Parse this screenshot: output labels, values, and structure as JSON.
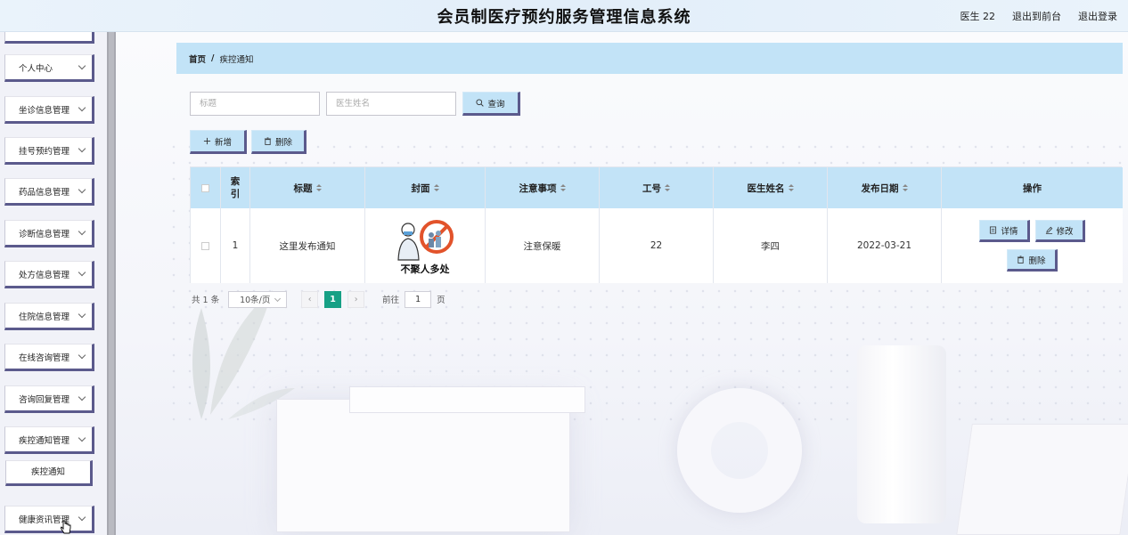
{
  "header": {
    "title": "会员制医疗预约服务管理信息系统",
    "user": "医生 22",
    "to_front": "退出到前台",
    "logout": "退出登录"
  },
  "sidebar": {
    "items": [
      {
        "label": ""
      },
      {
        "label": "个人中心"
      },
      {
        "label": "坐诊信息管理"
      },
      {
        "label": "挂号预约管理"
      },
      {
        "label": "药品信息管理"
      },
      {
        "label": "诊断信息管理"
      },
      {
        "label": "处方信息管理"
      },
      {
        "label": "住院信息管理"
      },
      {
        "label": "在线咨询管理"
      },
      {
        "label": "咨询回复管理"
      },
      {
        "label": "疾控通知管理"
      },
      {
        "label": "健康资讯管理"
      }
    ],
    "sub_item": "疾控通知"
  },
  "breadcrumb": {
    "home": "首页",
    "separator": "/",
    "current": "疾控通知"
  },
  "search": {
    "title_placeholder": "标题",
    "doctor_placeholder": "医生姓名",
    "query_label": "查询"
  },
  "toolbar": {
    "add_label": "新增",
    "delete_label": "删除"
  },
  "table": {
    "headers": {
      "index": "索引",
      "title": "标题",
      "cover": "封面",
      "notes": "注意事项",
      "job_no": "工号",
      "doctor": "医生姓名",
      "date": "发布日期",
      "ops": "操作"
    },
    "rows": [
      {
        "index": "1",
        "title": "这里发布通知",
        "cover_text": "不聚人多处",
        "notes": "注意保暖",
        "job_no": "22",
        "doctor": "李四",
        "date": "2022-03-21"
      }
    ],
    "ops": {
      "detail": "详情",
      "edit": "修改",
      "delete": "删除"
    }
  },
  "pagination": {
    "total": "共 1 条",
    "page_size": "10条/页",
    "prev": "‹",
    "next": "›",
    "current_page": "1",
    "goto_label": "前往",
    "goto_value": "1",
    "page_unit": "页"
  },
  "colors": {
    "accent": "#c2e3f7",
    "border_accent": "#5b5a8c",
    "page_active": "#16a085"
  }
}
